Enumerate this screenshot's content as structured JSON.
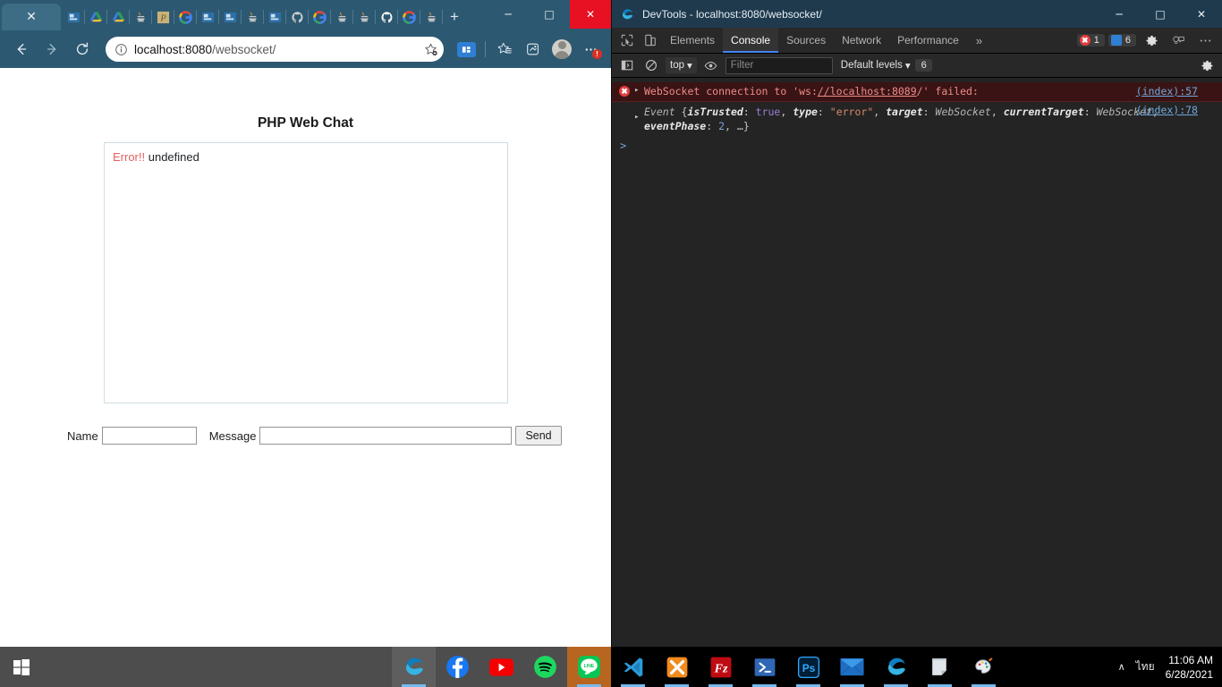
{
  "browser": {
    "window_controls": {
      "minimize": "─",
      "maximize": "□",
      "close": "✕"
    },
    "tab_close_label": "✕",
    "new_tab_label": "+",
    "tabs": [
      {
        "name": "active-tab",
        "icon": "close-icon"
      },
      {
        "name": "tab-windows-app",
        "icon": "windows-app-icon"
      },
      {
        "name": "tab-google-drive-1",
        "icon": "google-drive-icon"
      },
      {
        "name": "tab-google-drive-2",
        "icon": "google-drive-icon"
      },
      {
        "name": "tab-java-1",
        "icon": "java-duke-icon"
      },
      {
        "name": "tab-phpstorm",
        "icon": "phpstorm-icon"
      },
      {
        "name": "tab-google-1",
        "icon": "google-icon"
      },
      {
        "name": "tab-windows-app-2",
        "icon": "windows-app-icon"
      },
      {
        "name": "tab-windows-app-3",
        "icon": "windows-app-icon"
      },
      {
        "name": "tab-java-2",
        "icon": "java-duke-icon"
      },
      {
        "name": "tab-windows-app-4",
        "icon": "windows-app-icon"
      },
      {
        "name": "tab-github-1",
        "icon": "github-icon"
      },
      {
        "name": "tab-google-2",
        "icon": "google-icon"
      },
      {
        "name": "tab-java-3",
        "icon": "java-duke-icon"
      },
      {
        "name": "tab-java-4",
        "icon": "java-duke-icon"
      },
      {
        "name": "tab-github-2",
        "icon": "github-icon"
      },
      {
        "name": "tab-google-3",
        "icon": "google-icon"
      },
      {
        "name": "tab-java-5",
        "icon": "java-duke-icon"
      }
    ],
    "nav": {
      "back": "back-icon",
      "forward": "forward-icon",
      "reload": "reload-icon"
    },
    "omnibox": {
      "info_icon": "info-icon",
      "host": "localhost:8080",
      "path": "/websocket/",
      "full_url": "localhost:8080/websocket/",
      "favorite_icon": "star-add-icon"
    },
    "toolbar_icons": [
      "extension-badge-icon",
      "favorites-icon",
      "collections-icon",
      "profile-avatar",
      "more-settings-icon"
    ],
    "more_badge": "!"
  },
  "page": {
    "title": "PHP Web Chat",
    "chat": {
      "messages": [
        {
          "prefix": "Error!!",
          "text": " undefined"
        }
      ]
    },
    "form": {
      "name_label": "Name",
      "name_value": "",
      "name_placeholder": "",
      "message_label": "Message",
      "message_value": "",
      "message_placeholder": "",
      "send_label": "Send"
    }
  },
  "devtools": {
    "title": "DevTools - localhost:8080/websocket/",
    "logo_icon": "edge-logo-icon",
    "window_controls": {
      "minimize": "─",
      "maximize": "□",
      "close": "✕"
    },
    "left_icons": [
      "inspect-element-icon",
      "device-toolbar-icon"
    ],
    "tabs": [
      {
        "label": "Elements",
        "active": false
      },
      {
        "label": "Console",
        "active": true
      },
      {
        "label": "Sources",
        "active": false
      },
      {
        "label": "Network",
        "active": false
      },
      {
        "label": "Performance",
        "active": false
      }
    ],
    "more_tabs_label": "»",
    "error_count": "1",
    "message_count": "6",
    "gear_icon": "settings-gear-icon",
    "feedback_icon": "feedback-icon",
    "more_icon": "more-options-icon",
    "console_bar": {
      "sidebar_icon": "console-sidebar-icon",
      "clear_icon": "clear-console-icon",
      "context": "top",
      "context_caret": "▾",
      "eye_icon": "live-expression-icon",
      "filter_placeholder": "Filter",
      "filter_value": "",
      "levels": "Default levels",
      "levels_caret": "▾",
      "issues_count": "6",
      "settings_icon": "console-settings-icon"
    },
    "console": {
      "entries": [
        {
          "type": "error",
          "expander": "▸",
          "text_before": "WebSocket connection to '",
          "scheme": "ws:",
          "link_text": "//localhost:8089",
          "text_after": "/' failed:",
          "source": "(index):57"
        },
        {
          "type": "object",
          "expander": "▸",
          "class_name": "Event ",
          "props": [
            {
              "key": "isTrusted",
              "value": "true",
              "kind": "keyword"
            },
            {
              "key": "type",
              "value": "\"error\"",
              "kind": "string"
            },
            {
              "key": "target",
              "value": "WebSocket",
              "kind": "object"
            },
            {
              "key": "currentTarget",
              "value": "WebSocket",
              "kind": "object"
            },
            {
              "key": "eventPhase",
              "value": "2",
              "kind": "number"
            }
          ],
          "ellipsis": "…",
          "source": "(index):78"
        }
      ],
      "prompt": ">"
    }
  },
  "taskbar": {
    "start_icon": "windows-start-icon",
    "left_items": [
      {
        "name": "taskbar-edge",
        "icon": "edge-icon"
      },
      {
        "name": "taskbar-facebook",
        "icon": "facebook-icon"
      },
      {
        "name": "taskbar-youtube",
        "icon": "youtube-icon"
      },
      {
        "name": "taskbar-spotify",
        "icon": "spotify-icon"
      },
      {
        "name": "taskbar-line",
        "icon": "line-icon"
      }
    ],
    "right_items": [
      {
        "name": "taskbar-vscode",
        "icon": "vscode-icon"
      },
      {
        "name": "taskbar-xampp",
        "icon": "xampp-icon"
      },
      {
        "name": "taskbar-filezilla",
        "icon": "filezilla-icon"
      },
      {
        "name": "taskbar-powershell",
        "icon": "powershell-icon"
      },
      {
        "name": "taskbar-photoshop",
        "icon": "photoshop-icon"
      },
      {
        "name": "taskbar-mail",
        "icon": "mail-icon"
      },
      {
        "name": "taskbar-edge-2",
        "icon": "edge-icon"
      },
      {
        "name": "taskbar-sticky-notes",
        "icon": "sticky-notes-icon"
      },
      {
        "name": "taskbar-paint",
        "icon": "paint-icon"
      }
    ],
    "tray": {
      "chevron": "∧",
      "language": "ไทย",
      "time": "11:06 AM",
      "date": "6/28/2021"
    }
  }
}
